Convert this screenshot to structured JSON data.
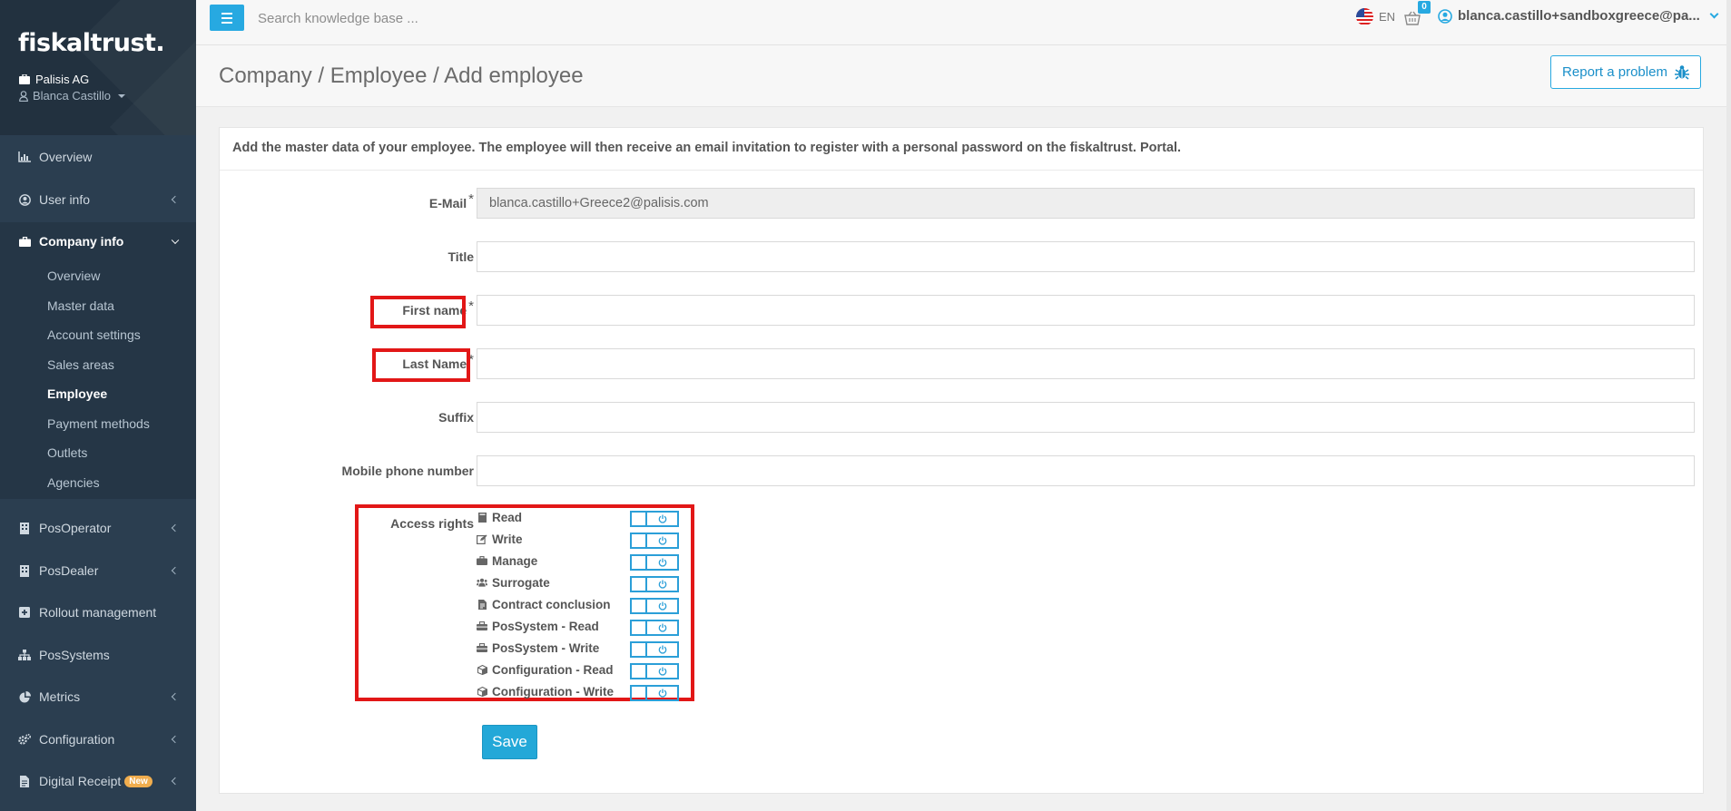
{
  "sidebar": {
    "logo": "fiskaltrust.",
    "company": "Palisis AG",
    "user": "Blanca Castillo",
    "items": [
      {
        "label": "Overview",
        "icon": "bar-chart-icon"
      },
      {
        "label": "User info",
        "icon": "user-circle-icon"
      },
      {
        "label": "Company info",
        "icon": "briefcase-icon"
      },
      {
        "label": "PosOperator",
        "icon": "building-icon"
      },
      {
        "label": "PosDealer",
        "icon": "building-icon"
      },
      {
        "label": "Rollout management",
        "icon": "plus-square-icon"
      },
      {
        "label": "PosSystems",
        "icon": "sitemap-icon"
      },
      {
        "label": "Metrics",
        "icon": "pie-chart-icon"
      },
      {
        "label": "Configuration",
        "icon": "gears-icon"
      },
      {
        "label": "Digital Receipt",
        "icon": "file-icon",
        "badge": "New"
      }
    ],
    "company_sub": [
      "Overview",
      "Master data",
      "Account settings",
      "Sales areas",
      "Employee",
      "Payment methods",
      "Outlets",
      "Agencies"
    ]
  },
  "topbar": {
    "search_placeholder": "Search knowledge base ...",
    "lang": "EN",
    "cart_count": "0",
    "account": "blanca.castillo+sandboxgreece@pa..."
  },
  "header": {
    "breadcrumb": "Company / Employee / Add employee",
    "report_label": "Report a problem"
  },
  "form": {
    "intro": "Add the master data of your employee. The employee will then receive an email invitation to register with a personal password on the fiskaltrust. Portal.",
    "required_mark": "*",
    "email_label": "E-Mail",
    "email_value": "blanca.castillo+Greece2@palisis.com",
    "title_label": "Title",
    "firstname_label": "First name",
    "lastname_label": "Last Name",
    "suffix_label": "Suffix",
    "mobile_label": "Mobile phone number",
    "access_label": "Access rights",
    "rights": [
      {
        "label": "Read",
        "icon": "book-icon"
      },
      {
        "label": "Write",
        "icon": "edit-icon"
      },
      {
        "label": "Manage",
        "icon": "briefcase-icon"
      },
      {
        "label": "Surrogate",
        "icon": "users-icon"
      },
      {
        "label": "Contract conclusion",
        "icon": "file-text-icon"
      },
      {
        "label": "PosSystem - Read",
        "icon": "toolbox-icon"
      },
      {
        "label": "PosSystem - Write",
        "icon": "toolbox-icon"
      },
      {
        "label": "Configuration - Read",
        "icon": "cube-icon"
      },
      {
        "label": "Configuration - Write",
        "icon": "cube-icon"
      }
    ],
    "save_label": "Save"
  },
  "colors": {
    "sidebar": "#2b3e50",
    "accent": "#27a9e1",
    "highlight": "#e21717"
  }
}
